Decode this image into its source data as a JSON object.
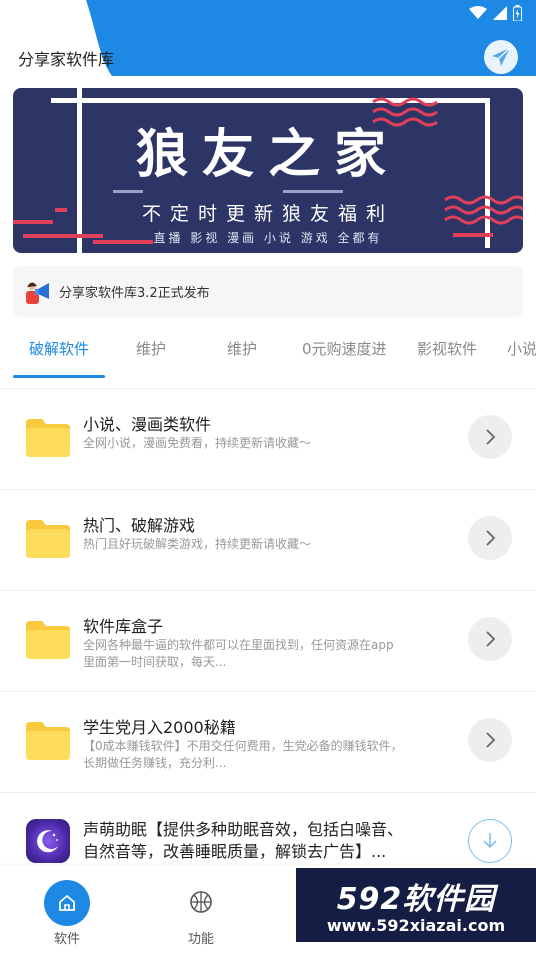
{
  "header": {
    "title": "分享家软件库",
    "accent": "#1e88e5",
    "status_icons": [
      "wifi-icon",
      "signal-icon",
      "battery-icon"
    ]
  },
  "banner": {
    "title": "狼友之家",
    "subtitle": "不定时更新狼友福利",
    "tagline": "直播 影视 漫画 小说 游戏 全都有",
    "background": "#2d3566"
  },
  "notice": {
    "icon": "megaphone-icon",
    "text": "分享家软件库3.2正式发布"
  },
  "tabs": [
    {
      "label": "破解软件",
      "active": true
    },
    {
      "label": "维护",
      "active": false
    },
    {
      "label": "维护",
      "active": false
    },
    {
      "label": "0元购速度进",
      "active": false
    },
    {
      "label": "影视软件",
      "active": false
    },
    {
      "label": "小说",
      "active": false
    }
  ],
  "list": [
    {
      "title": "小说、漫画类软件",
      "desc": "全网小说，漫画免费看，持续更新请收藏～",
      "icon": "folder-icon",
      "action": "chevron-right-icon"
    },
    {
      "title": "热门、破解游戏",
      "desc": "热门且好玩破解类游戏，持续更新请收藏～",
      "icon": "folder-icon",
      "action": "chevron-right-icon"
    },
    {
      "title": "软件库盒子",
      "desc": "全网各种最牛逼的软件都可以在里面找到，任何资源在app里面第一时间获取，每天...",
      "icon": "folder-icon",
      "action": "chevron-right-icon"
    },
    {
      "title": "学生党月入2000秘籍",
      "desc": "【0成本赚钱软件】不用交任何费用，生党必备的赚钱软件，长期做任务赚钱，充分利...",
      "icon": "folder-icon",
      "action": "chevron-right-icon"
    },
    {
      "title": "声萌助眠【提供多种助眠音效，包括白噪音、自然音等，改善睡眠质量，解锁去广告】...",
      "icon": "moon-app-icon",
      "action": "download-icon"
    }
  ],
  "bottom_nav": [
    {
      "label": "软件",
      "icon": "home-icon",
      "active": true
    },
    {
      "label": "功能",
      "icon": "basketball-icon",
      "active": false
    }
  ],
  "watermark": {
    "top": "592软件园",
    "bottom": "www.592xiazai.com"
  }
}
